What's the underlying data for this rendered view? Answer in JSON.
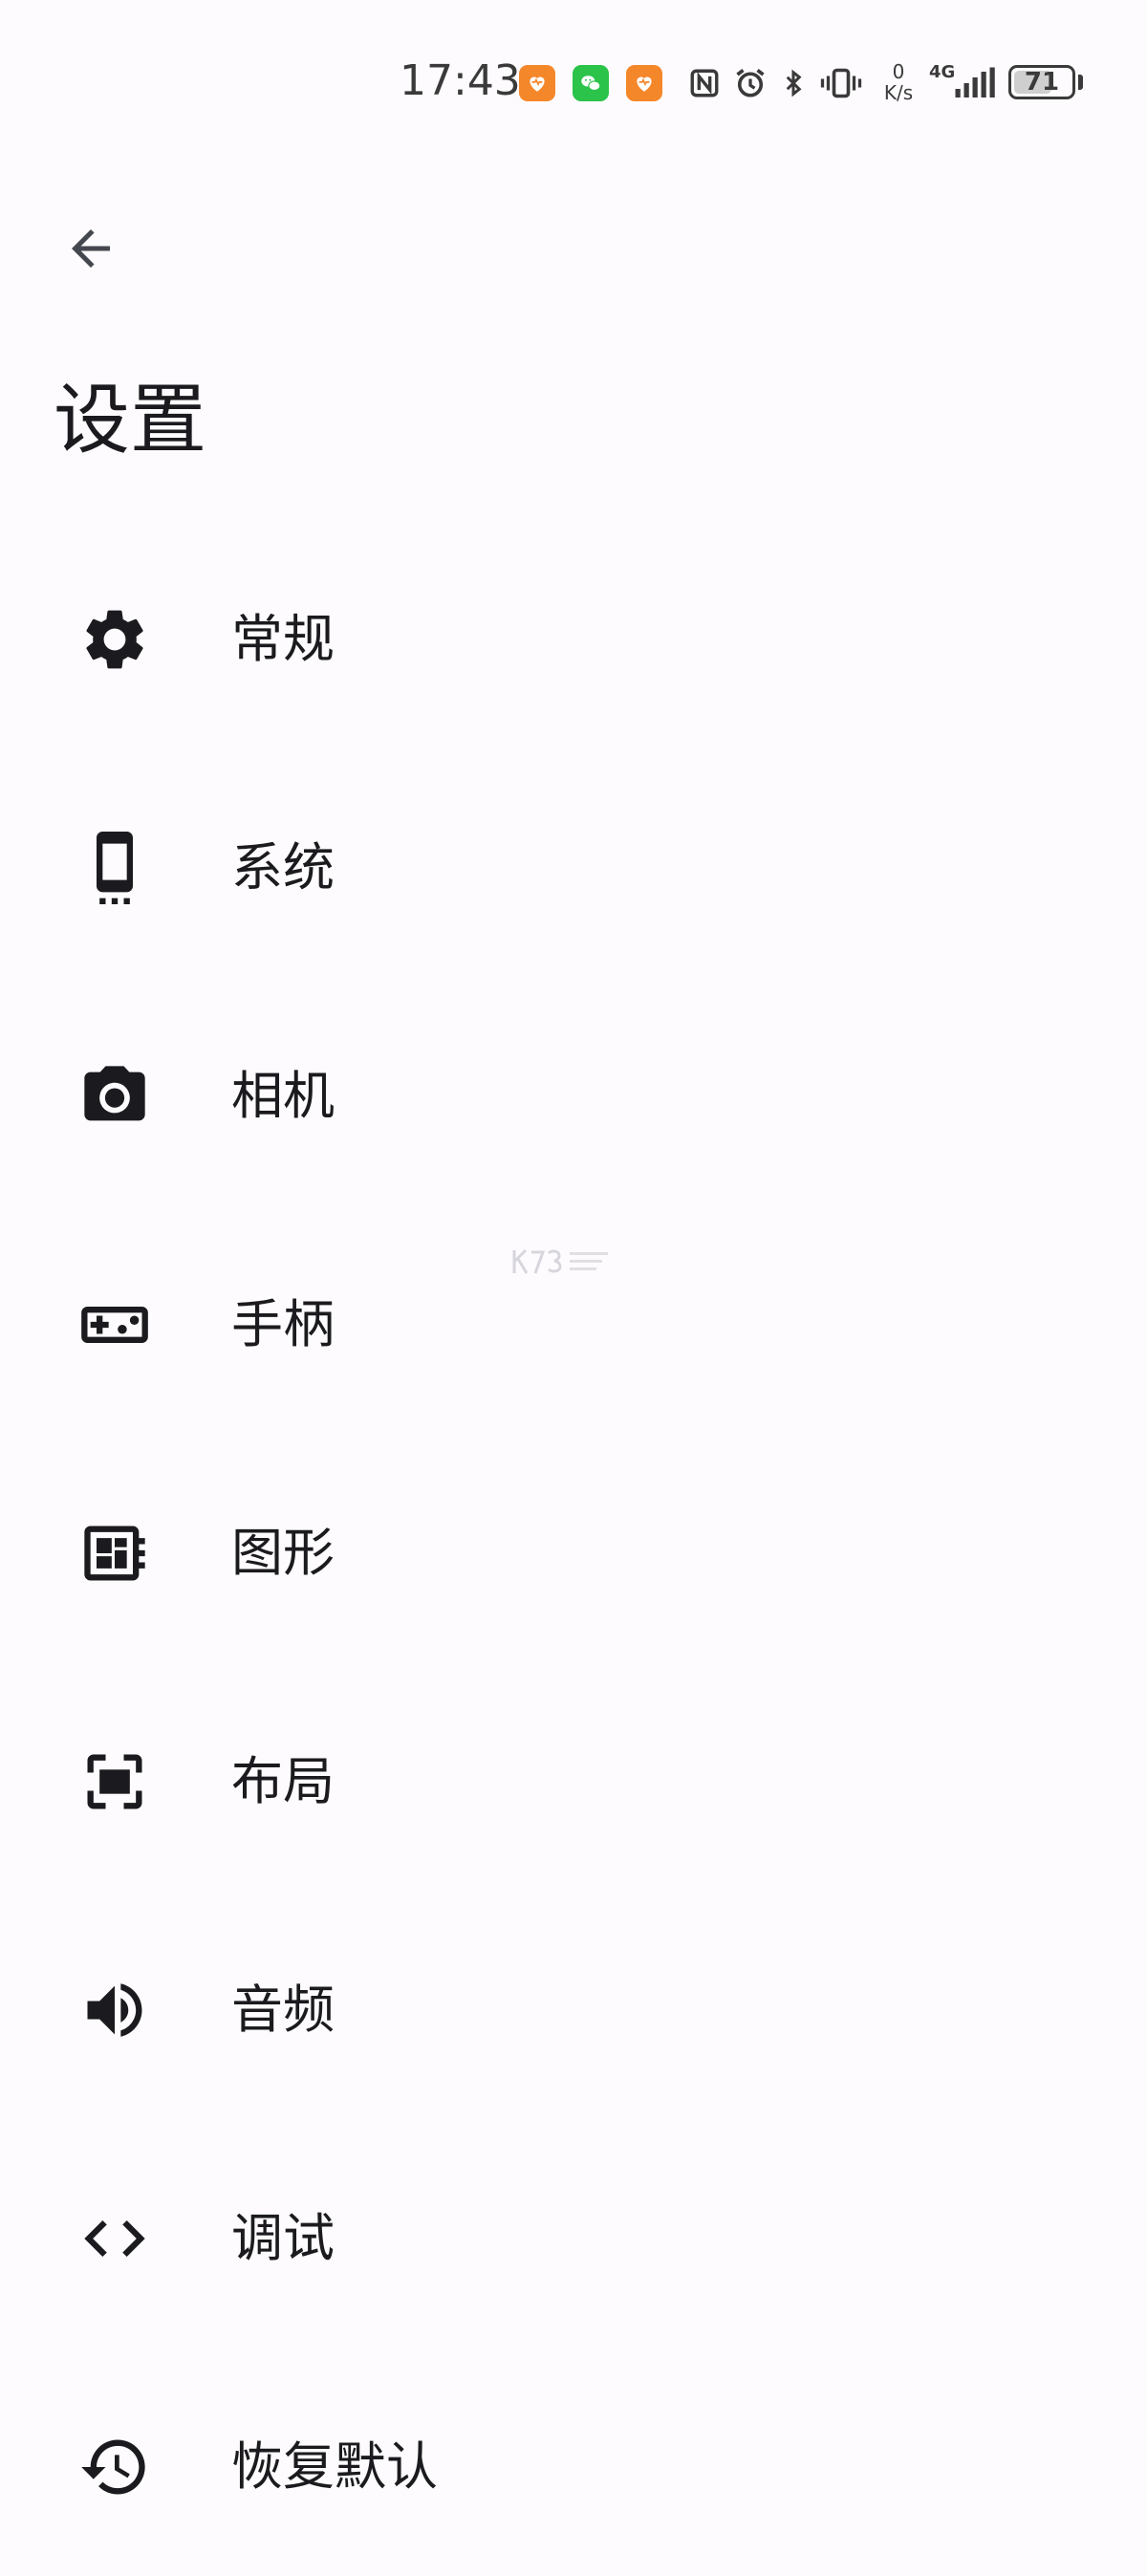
{
  "status_bar": {
    "time": "17:43",
    "net_speed_value": "0",
    "net_speed_unit": "K/s",
    "network_type": "4G",
    "battery_level": "71",
    "battery_fraction": 0.71,
    "icons": [
      "health-app-icon",
      "wechat-icon",
      "health-app-icon",
      "nfc-icon",
      "alarm-icon",
      "bluetooth-icon",
      "vibrate-icon",
      "signal-icon"
    ],
    "colors": {
      "app_orange": "#f5872b",
      "app_green": "#2bc34a",
      "icon_gray": "#3a3a3a"
    }
  },
  "app_bar": {
    "back_icon": "arrow-back-icon",
    "title": "设置"
  },
  "settings": {
    "items": [
      {
        "label": "常规",
        "icon": "gear-icon"
      },
      {
        "label": "系统",
        "icon": "phone-icon"
      },
      {
        "label": "相机",
        "icon": "camera-icon"
      },
      {
        "label": "手柄",
        "icon": "gamepad-icon"
      },
      {
        "label": "图形",
        "icon": "graphics-icon"
      },
      {
        "label": "布局",
        "icon": "layout-icon"
      },
      {
        "label": "音频",
        "icon": "speaker-icon"
      },
      {
        "label": "调试",
        "icon": "code-icon"
      },
      {
        "label": "恢复默认",
        "icon": "restore-icon"
      }
    ]
  },
  "theme": {
    "background": "#fdfbfd",
    "text": "#1b1b1f",
    "icon": "#1b1b1f"
  }
}
